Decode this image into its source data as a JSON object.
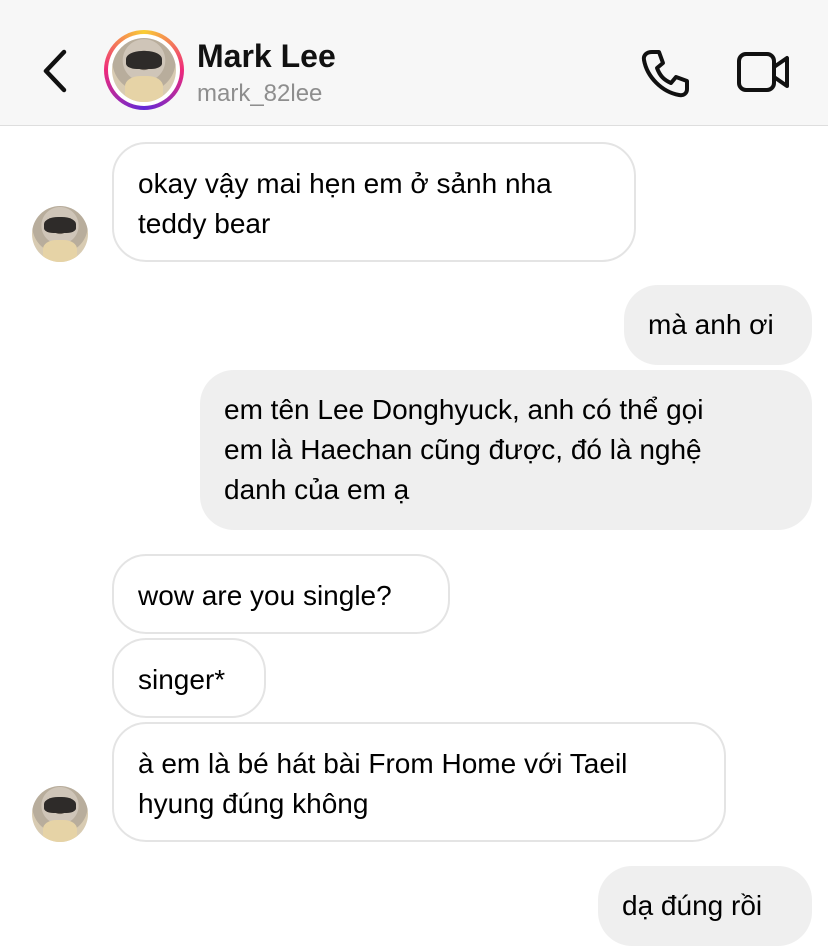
{
  "header": {
    "back_icon": "chevron-left-icon",
    "contact_name": "Mark Lee",
    "contact_handle": "mark_82lee",
    "call_icon": "phone-icon",
    "video_icon": "video-camera-icon"
  },
  "messages": [
    {
      "direction": "in",
      "text": "okay vậy mai hẹn em ở sảnh nha\nteddy bear"
    },
    {
      "direction": "out",
      "text": "mà anh ơi"
    },
    {
      "direction": "out",
      "text": "em tên Lee Donghyuck, anh có thể gọi\nem là Haechan cũng được, đó là nghệ\ndanh của em ạ"
    },
    {
      "direction": "in",
      "text": "wow are you single?"
    },
    {
      "direction": "in",
      "text": "singer*"
    },
    {
      "direction": "in",
      "text": "à em là bé hát bài From Home với Taeil\nhyung đúng không"
    },
    {
      "direction": "out",
      "text": "dạ đúng rồi"
    }
  ],
  "colors": {
    "incoming_bubble": "#ffffff",
    "outgoing_bubble": "#efefef",
    "header_bg": "#f7f7f7"
  }
}
